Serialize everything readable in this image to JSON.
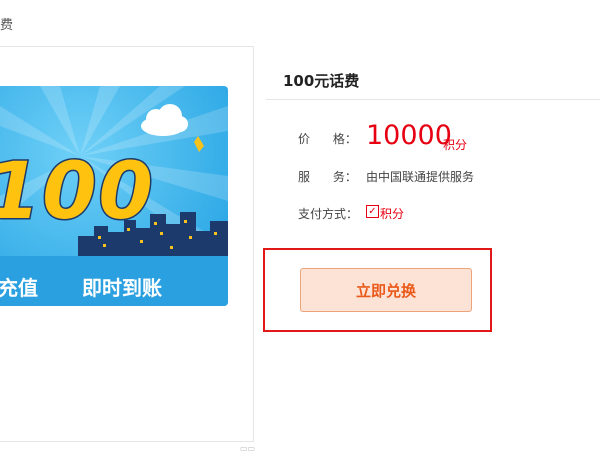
{
  "breadcrumb": {
    "text": "费"
  },
  "banner": {
    "big_number": "100",
    "slogan_left": "充值",
    "slogan_right": "即时到账"
  },
  "product": {
    "title": "100元话费",
    "price_label": "价      格：",
    "price_value": "10000",
    "price_unit": "积分",
    "service_label": "服      务：",
    "service_value": "由中国联通提供服务",
    "payment_label": "支付方式：",
    "payment_value": "积分",
    "payment_checked": true
  },
  "actions": {
    "redeem_label": "立即兑换"
  },
  "colors": {
    "price": "#e60012",
    "banner_blue": "#2aa8e8",
    "highlight_frame": "#e01818",
    "button_text": "#ea5a1a"
  }
}
